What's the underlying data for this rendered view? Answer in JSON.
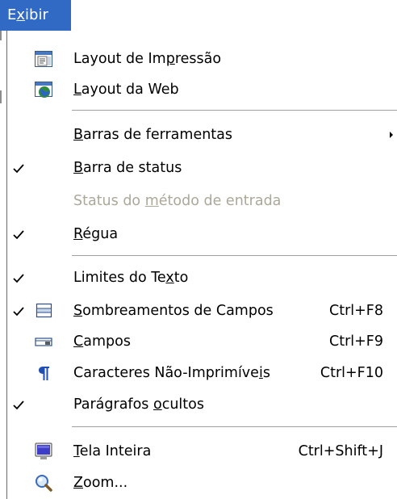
{
  "menu_title": {
    "pre": "E",
    "mn": "x",
    "post": "ibir"
  },
  "items": [
    {
      "pre": "Layout de Im",
      "mn": "p",
      "post": "ressão",
      "accel": ""
    },
    {
      "pre": "",
      "mn": "L",
      "post": "ayout da Web",
      "accel": ""
    },
    {
      "pre": "",
      "mn": "B",
      "post": "arras de ferramentas",
      "accel": ""
    },
    {
      "pre": "",
      "mn": "B",
      "post": "arra de status",
      "accel": ""
    },
    {
      "pre": "Status do ",
      "mn": "m",
      "post": "étodo de entrada",
      "accel": ""
    },
    {
      "pre": "",
      "mn": "R",
      "post": "égua",
      "accel": ""
    },
    {
      "pre": "Limites do Te",
      "mn": "x",
      "post": "to",
      "accel": ""
    },
    {
      "pre": "",
      "mn": "S",
      "post": "ombreamentos de Campos",
      "accel": "Ctrl+F8"
    },
    {
      "pre": "",
      "mn": "C",
      "post": "ampos",
      "accel": "Ctrl+F9"
    },
    {
      "pre": "Caracteres Não-Imprimíve",
      "mn": "i",
      "post": "s",
      "accel": "Ctrl+F10"
    },
    {
      "pre": "Parágrafos ",
      "mn": "o",
      "post": "cultos",
      "accel": ""
    },
    {
      "pre": "",
      "mn": "T",
      "post": "ela Inteira",
      "accel": "Ctrl+Shift+J"
    },
    {
      "pre": "",
      "mn": "Z",
      "post": "oom...",
      "accel": ""
    }
  ],
  "colors": {
    "highlight": "#316AC5",
    "disabled_text": "#aca899"
  },
  "icons": [
    "print-layout-icon",
    "web-layout-icon",
    "field-shadings-icon",
    "fields-icon",
    "pilcrow-icon",
    "full-screen-icon",
    "zoom-magnifier-icon"
  ]
}
